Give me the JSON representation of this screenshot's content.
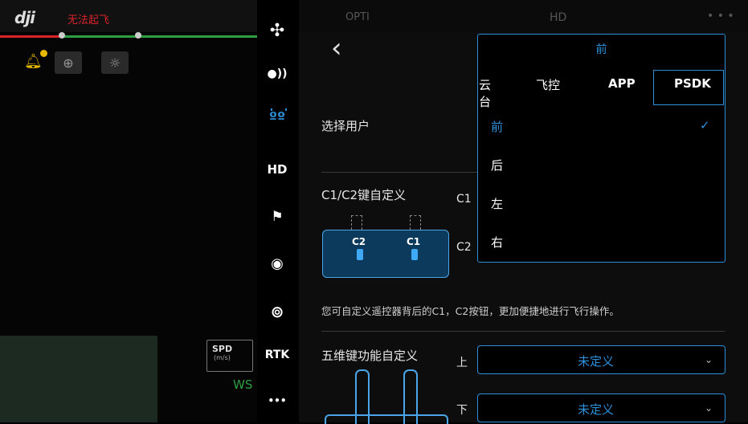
{
  "camera": {
    "brand": "dji",
    "warning": "无法起飞",
    "speed_label": "SPD",
    "speed_unit": "(m/s)",
    "wind_label": "WS"
  },
  "sidebar": {
    "items": [
      {
        "name": "aircraft",
        "label": "✣"
      },
      {
        "name": "signal",
        "label": "●))"
      },
      {
        "name": "remote",
        "label": "ºº"
      },
      {
        "name": "hd",
        "label": "HD"
      },
      {
        "name": "battery",
        "label": "⚑"
      },
      {
        "name": "camera",
        "label": "◉"
      },
      {
        "name": "gimbal",
        "label": "⊚"
      },
      {
        "name": "rtk",
        "label": "RTK"
      },
      {
        "name": "more",
        "label": "•••"
      }
    ]
  },
  "header": {
    "mode": "OPTI",
    "hd": "HD",
    "dots": "• • •"
  },
  "settings": {
    "select_user_label": "选择用户",
    "c1c2_label": "C1/C2键自定义",
    "c1_label": "C1",
    "c2_label": "C2",
    "rc_c1": "C1",
    "rc_c2": "C2",
    "c1c2_desc": "您可自定义遥控器背后的C1，C2按钮，更加便捷地进行飞行操作。",
    "fiveway_label": "五维键功能自定义",
    "up_label": "上",
    "down_label": "下",
    "up_value": "未定义",
    "down_value": "未定义"
  },
  "dropdown": {
    "title": "前",
    "tabs": [
      "云台",
      "飞控",
      "APP",
      "PSDK"
    ],
    "active_tab": "PSDK",
    "options": [
      "前",
      "后",
      "左",
      "右"
    ],
    "selected": "前"
  },
  "colors": {
    "accent": "#2d8fd8",
    "warning": "#d9232a",
    "ok": "#2ea043"
  }
}
